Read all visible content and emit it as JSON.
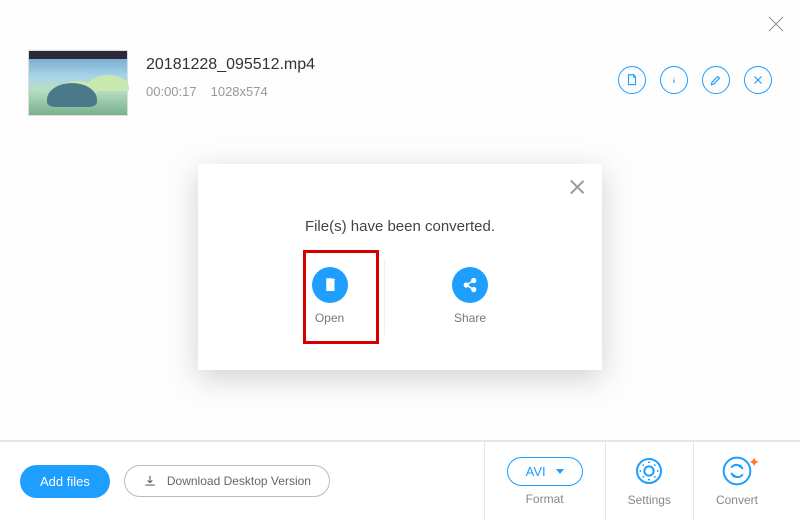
{
  "file": {
    "name": "20181228_095512.mp4",
    "duration": "00:00:17",
    "dimensions": "1028x574"
  },
  "modal": {
    "message": "File(s) have been converted.",
    "actions": {
      "open": "Open",
      "share": "Share"
    }
  },
  "toolbar": {
    "addFiles": "Add files",
    "downloadDesktop": "Download Desktop Version"
  },
  "controls": {
    "format": {
      "selected": "AVI",
      "label": "Format"
    },
    "settings": "Settings",
    "convert": "Convert"
  },
  "colors": {
    "accent": "#1e9eff",
    "highlight": "#d40000",
    "sparkle": "#ff7a1a"
  }
}
